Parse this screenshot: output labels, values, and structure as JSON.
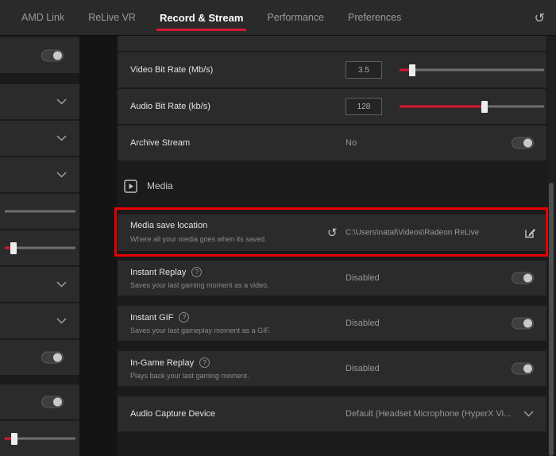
{
  "colors": {
    "accent": "#d81733",
    "highlight": "#e60000"
  },
  "icons": {
    "undo": "↺",
    "help": "?"
  },
  "nav": {
    "tabs": [
      "AMD Link",
      "ReLive VR",
      "Record & Stream",
      "Performance",
      "Preferences"
    ],
    "active_tab": "Record & Stream"
  },
  "sidebar": {
    "slider_plain_pct": 0,
    "slider_red_pct": 12,
    "slider_bottom_pct": 14
  },
  "main": {
    "video_bitrate": {
      "label": "Video Bit Rate (Mb/s)",
      "value": "3.5",
      "slider_percent": 9
    },
    "audio_bitrate": {
      "label": "Audio Bit Rate (kb/s)",
      "value": "128",
      "slider_percent": 59
    },
    "archive_stream": {
      "label": "Archive Stream",
      "value": "No",
      "toggle": "off"
    },
    "media_section": {
      "title": "Media"
    },
    "media_save": {
      "label": "Media save location",
      "description": "Where all your media goes when its saved.",
      "path": "C:\\Users\\natal\\Videos\\Radeon ReLive"
    },
    "instant_replay": {
      "label": "Instant Replay",
      "description": "Saves your last gaming moment as a video.",
      "value": "Disabled",
      "toggle": "off"
    },
    "instant_gif": {
      "label": "Instant GIF",
      "description": "Saves your last gameplay moment as a GIF.",
      "value": "Disabled",
      "toggle": "off"
    },
    "ingame_replay": {
      "label": "In-Game Replay",
      "description": "Plays back your last gaming moment.",
      "value": "Disabled",
      "toggle": "off"
    },
    "audio_capture": {
      "label": "Audio Capture Device",
      "value": "Default (Headset Microphone (HyperX Vi..."
    }
  }
}
